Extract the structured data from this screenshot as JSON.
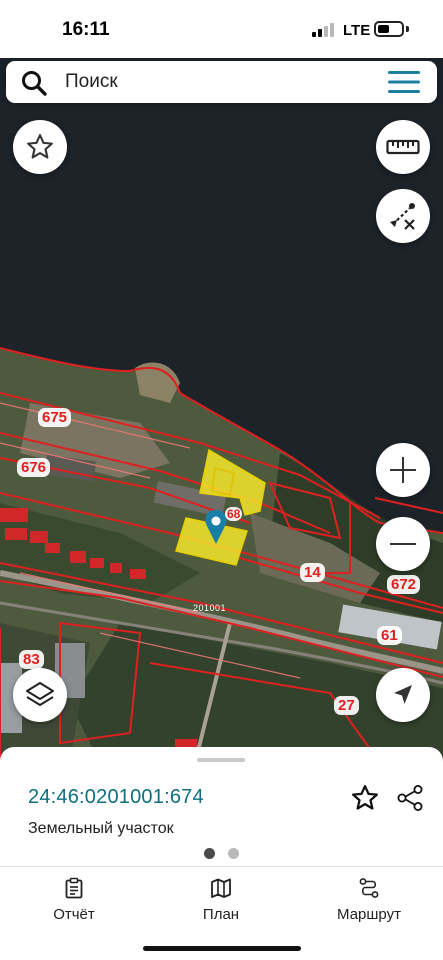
{
  "status_bar": {
    "time": "16:11",
    "network": "LTE"
  },
  "search": {
    "placeholder": "Поиск"
  },
  "map": {
    "parcel_labels": [
      "675",
      "676",
      "14",
      "672",
      "61",
      "83",
      "27",
      "68"
    ],
    "quarter_label": "201001"
  },
  "sheet": {
    "cadastral_number": "24:46:0201001:674",
    "object_type": "Земельный участок"
  },
  "tabs": [
    {
      "label": "Отчёт",
      "icon": "report-icon"
    },
    {
      "label": "План",
      "icon": "map-plan-icon"
    },
    {
      "label": "Маршрут",
      "icon": "route-icon"
    }
  ],
  "colors": {
    "accent": "#0f6f80",
    "parcel_border": "#e02020",
    "selected_parcel": "#f5e82a",
    "pin": "#1a7fa6"
  }
}
